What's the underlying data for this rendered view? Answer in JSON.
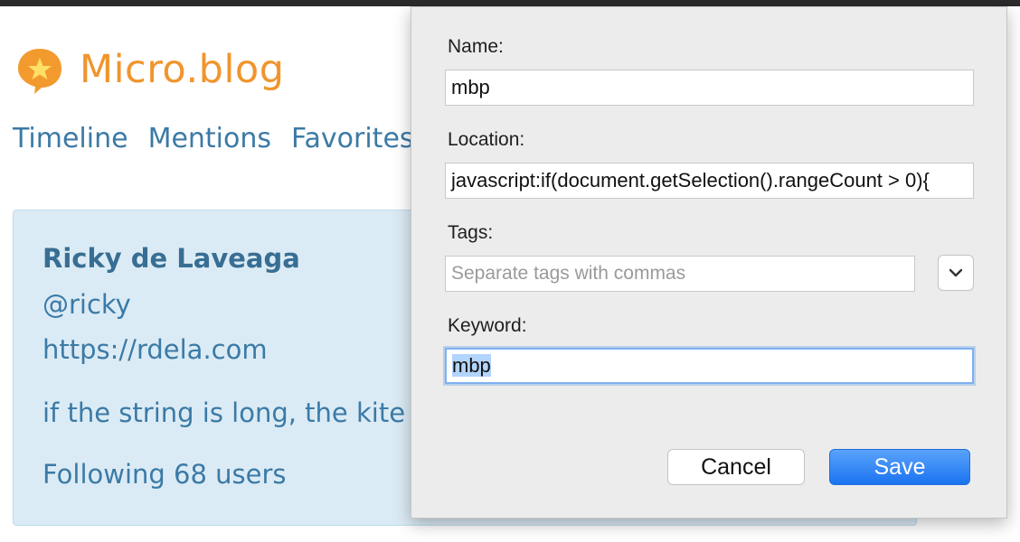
{
  "background": {
    "logo_text": "Micro.blog",
    "nav": [
      "Timeline",
      "Mentions",
      "Favorites"
    ],
    "profile": {
      "name": "Ricky de Laveaga",
      "handle": "@ricky",
      "url": "https://rdela.com",
      "bio": "if the string is long, the kite f",
      "following": "Following 68 users"
    }
  },
  "dialog": {
    "name_label": "Name:",
    "name_value": "mbp",
    "location_label": "Location:",
    "location_value": "javascript:if(document.getSelection().rangeCount > 0){",
    "tags_label": "Tags:",
    "tags_placeholder": "Separate tags with commas",
    "keyword_label": "Keyword:",
    "keyword_value": "mbp",
    "cancel_label": "Cancel",
    "save_label": "Save"
  },
  "icons": {
    "logo": "star-speech-bubble-icon",
    "tags_dropdown": "chevron-down-icon"
  },
  "colors": {
    "brand_orange": "#f0952d",
    "link_blue": "#3b7aa6",
    "card_bg": "#dbebf5",
    "save_button": "#1a73f0"
  }
}
